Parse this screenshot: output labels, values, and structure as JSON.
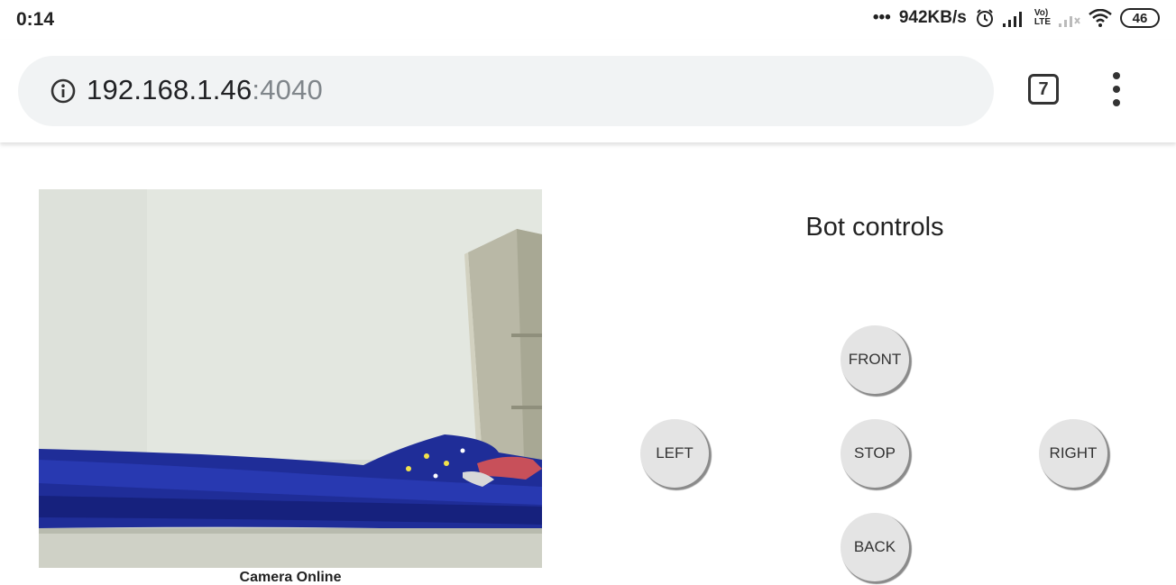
{
  "status_bar": {
    "time": "0:14",
    "network_speed": "942KB/s",
    "network_type": "LTE",
    "volte_label": "Vo)",
    "battery": "46"
  },
  "browser": {
    "url_host": "192.168.1.46",
    "url_port": ":4040",
    "tab_count": "7"
  },
  "camera": {
    "status": "Camera Online"
  },
  "controls": {
    "title": "Bot controls",
    "front_label": "FRONT",
    "left_label": "LEFT",
    "stop_label": "STOP",
    "right_label": "RIGHT",
    "back_label": "BACK"
  },
  "icons": {
    "info": "info-icon",
    "menu": "more-vert-icon",
    "alarm": "alarm-icon",
    "signal": "signal-icon",
    "wifi": "wifi-icon",
    "battery": "battery-icon"
  }
}
